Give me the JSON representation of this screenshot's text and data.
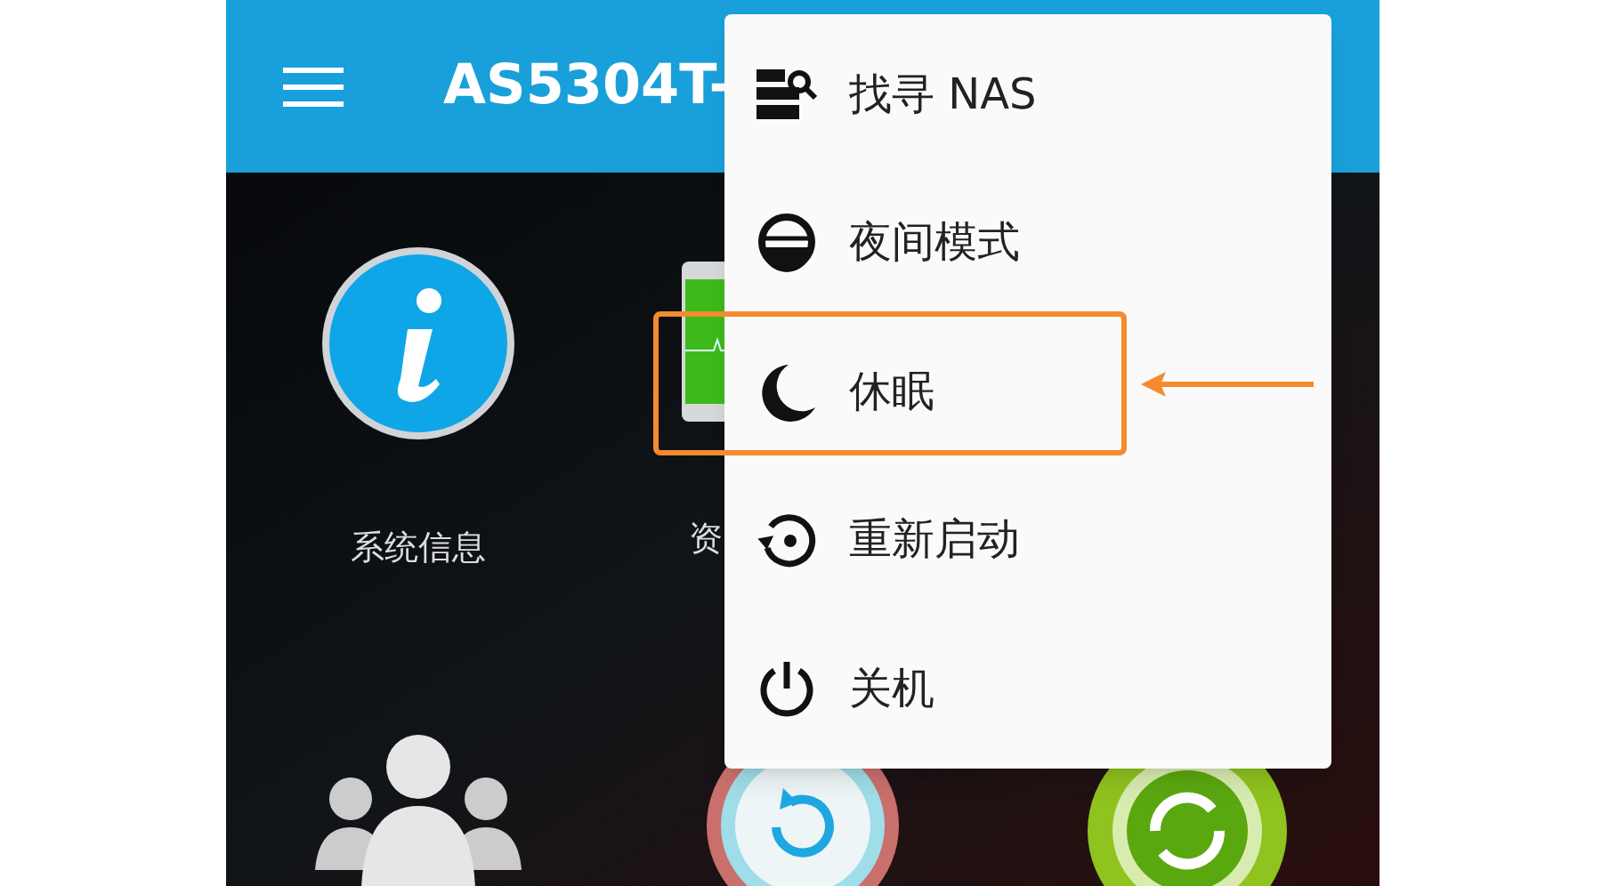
{
  "app_bar": {
    "title": "AS5304T-"
  },
  "tiles": [
    {
      "kind": "info",
      "label": "系统信息"
    },
    {
      "kind": "monitor",
      "label": "资"
    },
    {
      "kind": "users"
    },
    {
      "kind": "refresh"
    },
    {
      "kind": "sync"
    }
  ],
  "menu": [
    {
      "kind": "find",
      "label": "找寻 NAS",
      "highlighted": false
    },
    {
      "kind": "night",
      "label": "夜间模式",
      "highlighted": false
    },
    {
      "kind": "sleep",
      "label": "休眠",
      "highlighted": true
    },
    {
      "kind": "restart",
      "label": "重新启动",
      "highlighted": false
    },
    {
      "kind": "power",
      "label": "关机",
      "highlighted": false
    }
  ]
}
